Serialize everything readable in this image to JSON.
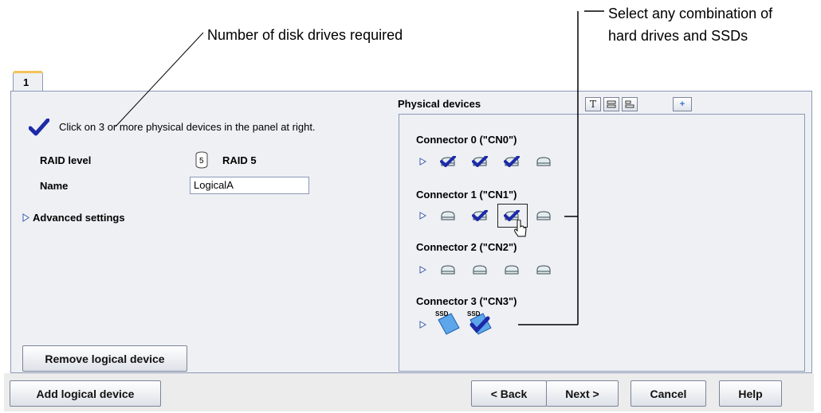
{
  "callouts": {
    "disks_required": "Number of disk drives required",
    "select_line1": "Select any combination of",
    "select_line2": "hard drives and SSDs"
  },
  "tab": {
    "label": "1"
  },
  "left_panel": {
    "instruction": "Click on 3 or more physical devices in the panel at right.",
    "raid_label": "RAID level",
    "raid_icon_number": "5",
    "raid_value": "RAID 5",
    "name_label": "Name",
    "name_value": "LogicalA",
    "advanced_label": "Advanced settings",
    "remove_button": "Remove logical device"
  },
  "physical": {
    "title": "Physical devices",
    "toolbar": {
      "text_view": "T",
      "plus": "+"
    },
    "connectors": [
      {
        "label": "Connector 0 (\"CN0\")"
      },
      {
        "label": "Connector 1 (\"CN1\")"
      },
      {
        "label": "Connector 2 (\"CN2\")"
      },
      {
        "label": "Connector 3 (\"CN3\")"
      }
    ],
    "ssd_label": "SSD"
  },
  "bottom": {
    "add": "Add logical device",
    "back": "< Back",
    "next": "Next >",
    "cancel": "Cancel",
    "help": "Help"
  },
  "colors": {
    "check": "#1d2aa8",
    "accent": "#f3c35a",
    "panel": "#eef0f4"
  }
}
